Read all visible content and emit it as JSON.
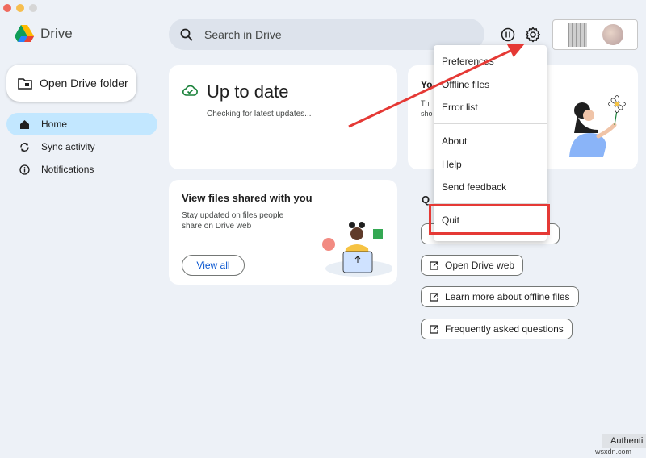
{
  "app": {
    "name": "Drive"
  },
  "search": {
    "placeholder": "Search in Drive"
  },
  "sidebar": {
    "open_folder_label": "Open Drive folder",
    "items": [
      {
        "label": "Home",
        "active": true,
        "icon": "home-icon"
      },
      {
        "label": "Sync activity",
        "active": false,
        "icon": "sync-icon"
      },
      {
        "label": "Notifications",
        "active": false,
        "icon": "info-icon"
      }
    ]
  },
  "status_card": {
    "title": "Up to date",
    "subtitle": "Checking for latest updates..."
  },
  "shared_card": {
    "title": "View files shared with you",
    "line1": "Stay updated on files people",
    "line2": "share on Drive web",
    "button": "View all"
  },
  "promo_card": {
    "title_partial": "Yo",
    "line1_partial": "Thi",
    "line2_partial": "sho"
  },
  "quick_links": {
    "heading_partial": "Q",
    "items": [
      "Open Drive web",
      "Learn more about offline files",
      "Frequently asked questions"
    ]
  },
  "settings_menu": {
    "items": [
      "Preferences",
      "Offline files",
      "Error list",
      "About",
      "Help",
      "Send feedback",
      "Quit"
    ]
  },
  "footer": {
    "auth_label": "Authenti",
    "watermark": "wsxdn.com"
  },
  "colors": {
    "accent": "#0b57d0",
    "active_nav": "#c2e7ff",
    "highlight": "#e53935",
    "background": "#edf1f7"
  }
}
